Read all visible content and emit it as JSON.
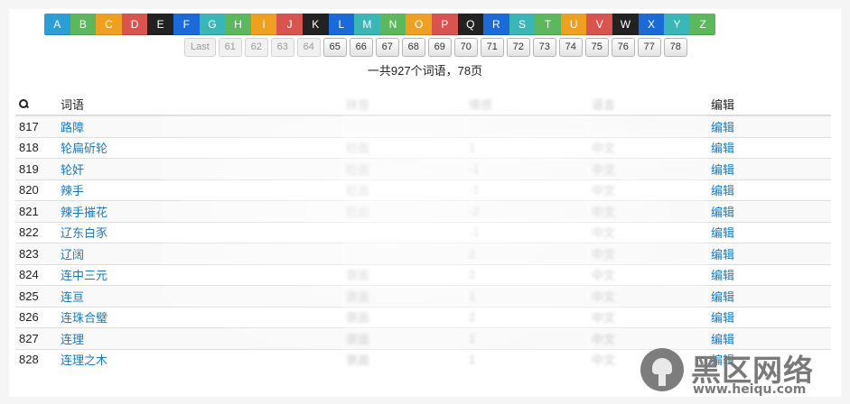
{
  "alphabet": [
    {
      "letter": "A",
      "color": "#2a9fd6"
    },
    {
      "letter": "B",
      "color": "#5cb85c"
    },
    {
      "letter": "C",
      "color": "#f0a020"
    },
    {
      "letter": "D",
      "color": "#d9534f"
    },
    {
      "letter": "E",
      "color": "#222222"
    },
    {
      "letter": "F",
      "color": "#1a6ad9"
    },
    {
      "letter": "G",
      "color": "#3bb6b6"
    },
    {
      "letter": "H",
      "color": "#5cb85c"
    },
    {
      "letter": "I",
      "color": "#f0a020"
    },
    {
      "letter": "J",
      "color": "#d9534f"
    },
    {
      "letter": "K",
      "color": "#222222"
    },
    {
      "letter": "L",
      "color": "#1a6ad9"
    },
    {
      "letter": "M",
      "color": "#3bb6b6"
    },
    {
      "letter": "N",
      "color": "#5cb85c"
    },
    {
      "letter": "O",
      "color": "#f0a020"
    },
    {
      "letter": "P",
      "color": "#d9534f"
    },
    {
      "letter": "Q",
      "color": "#222222"
    },
    {
      "letter": "R",
      "color": "#1a6ad9"
    },
    {
      "letter": "S",
      "color": "#3bb6b6"
    },
    {
      "letter": "T",
      "color": "#5cb85c"
    },
    {
      "letter": "U",
      "color": "#f0a020"
    },
    {
      "letter": "V",
      "color": "#d9534f"
    },
    {
      "letter": "W",
      "color": "#222222"
    },
    {
      "letter": "X",
      "color": "#1a6ad9"
    },
    {
      "letter": "Y",
      "color": "#3bb6b6"
    },
    {
      "letter": "Z",
      "color": "#5cb85c"
    }
  ],
  "pager": {
    "first": "Last",
    "pages": [
      {
        "n": "61",
        "disabled": true
      },
      {
        "n": "62",
        "disabled": true
      },
      {
        "n": "63",
        "disabled": true
      },
      {
        "n": "64",
        "disabled": true
      },
      {
        "n": "65",
        "disabled": false
      },
      {
        "n": "66",
        "disabled": false
      },
      {
        "n": "67",
        "disabled": false
      },
      {
        "n": "68",
        "disabled": false
      },
      {
        "n": "69",
        "disabled": false
      },
      {
        "n": "70",
        "disabled": false
      },
      {
        "n": "71",
        "disabled": false
      },
      {
        "n": "72",
        "disabled": false
      },
      {
        "n": "73",
        "disabled": false
      },
      {
        "n": "74",
        "disabled": false
      },
      {
        "n": "75",
        "disabled": false
      },
      {
        "n": "76",
        "disabled": false
      },
      {
        "n": "77",
        "disabled": false
      },
      {
        "n": "78",
        "disabled": false
      }
    ]
  },
  "summary": "一共927个词语，78页",
  "table": {
    "headers": {
      "search_icon": "search-icon",
      "word": "词语",
      "pinyin": "拼音",
      "emotion": "情感",
      "lang": "语言",
      "edit": "编辑"
    },
    "rows": [
      {
        "id": "817",
        "word": "路障",
        "col3": "",
        "col4": "",
        "col5": "",
        "edit": "编辑"
      },
      {
        "id": "818",
        "word": "轮扁斫轮",
        "col3": "贬面",
        "col4": "1",
        "col5": "中文",
        "edit": "编辑"
      },
      {
        "id": "819",
        "word": "轮奸",
        "col3": "贬面",
        "col4": "-1",
        "col5": "中文",
        "edit": "编辑"
      },
      {
        "id": "820",
        "word": "辣手",
        "col3": "贬面",
        "col4": "-1",
        "col5": "中文",
        "edit": "编辑"
      },
      {
        "id": "821",
        "word": "辣手摧花",
        "col3": "贬面",
        "col4": "-2",
        "col5": "中文",
        "edit": "编辑"
      },
      {
        "id": "822",
        "word": "辽东白豕",
        "col3": "",
        "col4": "-1",
        "col5": "中文",
        "edit": "编辑"
      },
      {
        "id": "823",
        "word": "辽阔",
        "col3": "",
        "col4": "2",
        "col5": "中文",
        "edit": "编辑"
      },
      {
        "id": "824",
        "word": "连中三元",
        "col3": "褒面",
        "col4": "2",
        "col5": "中文",
        "edit": "编辑"
      },
      {
        "id": "825",
        "word": "连亘",
        "col3": "褒面",
        "col4": "1",
        "col5": "中文",
        "edit": "编辑"
      },
      {
        "id": "826",
        "word": "连珠合璧",
        "col3": "褒面",
        "col4": "2",
        "col5": "中文",
        "edit": "编辑"
      },
      {
        "id": "827",
        "word": "连理",
        "col3": "褒面",
        "col4": "1",
        "col5": "中文",
        "edit": "编辑"
      },
      {
        "id": "828",
        "word": "连理之木",
        "col3": "褒面",
        "col4": "1",
        "col5": "中文",
        "edit": "编辑"
      }
    ]
  },
  "watermark": {
    "cn": "黑区网络",
    "en": "www.heiqu.com"
  }
}
